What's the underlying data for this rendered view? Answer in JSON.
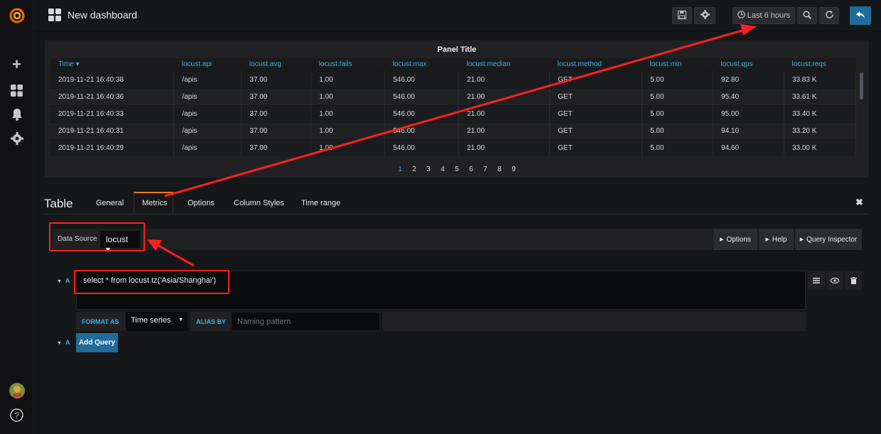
{
  "header": {
    "title": "New dashboard",
    "time_range": "Last 6 hours"
  },
  "panel": {
    "title": "Panel Title",
    "columns": [
      "Time ▾",
      "locust.api",
      "locust.avg",
      "locust.fails",
      "locust.max",
      "locust.median",
      "locust.method",
      "locust.min",
      "locust.qps",
      "locust.reqs"
    ],
    "rows": [
      [
        "2019-11-21 16:40:38",
        "/apis",
        "37.00",
        "1.00",
        "546.00",
        "21.00",
        "GET",
        "5.00",
        "92.80",
        "33.83 K"
      ],
      [
        "2019-11-21 16:40:36",
        "/apis",
        "37.00",
        "1.00",
        "546.00",
        "21.00",
        "GET",
        "5.00",
        "95.40",
        "33.61 K"
      ],
      [
        "2019-11-21 16:40:33",
        "/apis",
        "37.00",
        "1.00",
        "546.00",
        "21.00",
        "GET",
        "5.00",
        "95.00",
        "33.40 K"
      ],
      [
        "2019-11-21 16:40:31",
        "/apis",
        "37.00",
        "1.00",
        "546.00",
        "21.00",
        "GET",
        "5.00",
        "94.10",
        "33.20 K"
      ],
      [
        "2019-11-21 16:40:29",
        "/apis",
        "37.00",
        "1.00",
        "546.00",
        "21.00",
        "GET",
        "5.00",
        "94.60",
        "33.00 K"
      ]
    ],
    "pages": [
      "1",
      "2",
      "3",
      "4",
      "5",
      "6",
      "7",
      "8",
      "9"
    ],
    "active_page": "1"
  },
  "editor": {
    "title": "Table",
    "tabs": [
      "General",
      "Metrics",
      "Options",
      "Column Styles",
      "Time range"
    ],
    "active_tab": "Metrics",
    "close": "✖"
  },
  "datasource": {
    "label": "Data Source",
    "value": "locust ▾",
    "options_btn": "Options",
    "help_btn": "Help",
    "inspector_btn": "Query Inspector"
  },
  "query": {
    "ref": "A",
    "text": "select * from locust tz('Asia/Shanghai')",
    "format_label": "FORMAT AS",
    "format_value": "Time series",
    "alias_label": "ALIAS BY",
    "alias_placeholder": "Naming pattern",
    "add_label": "Add Query"
  },
  "colors": {
    "accent": "#33b5e5",
    "brand": "#eb7b18",
    "annotation": "#ff2020",
    "primary": "#1f6b9a"
  }
}
